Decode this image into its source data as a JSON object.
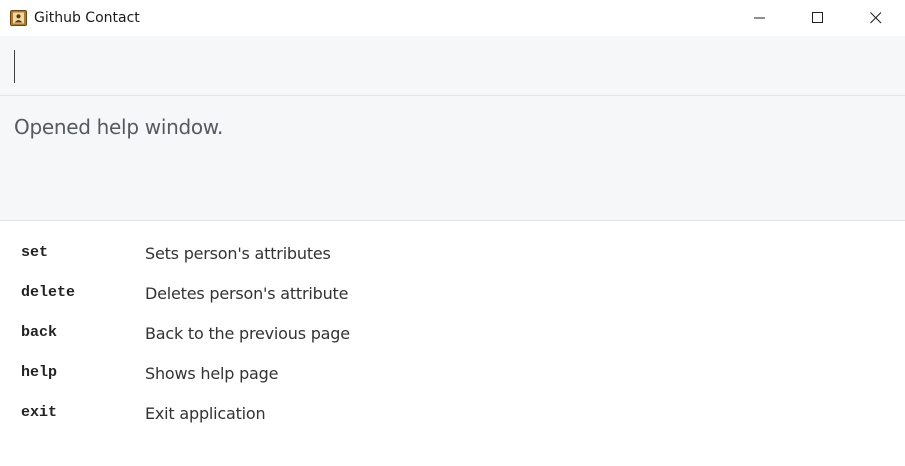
{
  "window": {
    "title": "Github Contact",
    "icon": "contact-book-icon"
  },
  "command_box": {
    "value": "",
    "placeholder": ""
  },
  "result": {
    "text": "Opened help window."
  },
  "help": {
    "items": [
      {
        "command": "set",
        "description": "Sets person's attributes"
      },
      {
        "command": "delete",
        "description": "Deletes person's attribute"
      },
      {
        "command": "back",
        "description": "Back to the previous page"
      },
      {
        "command": "help",
        "description": "Shows help page"
      },
      {
        "command": "exit",
        "description": "Exit application"
      }
    ]
  }
}
